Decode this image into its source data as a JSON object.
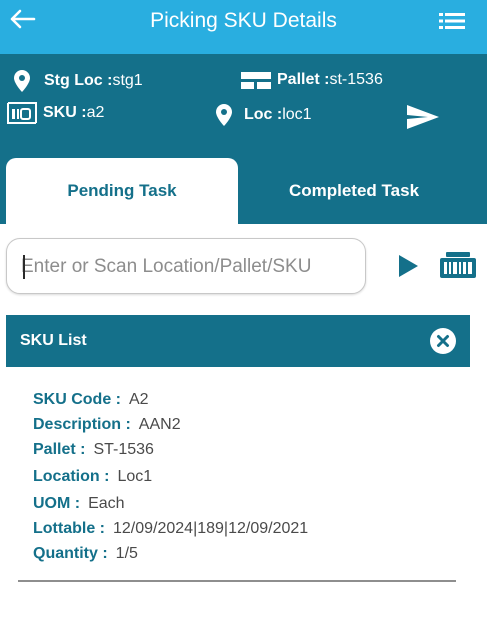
{
  "appbar": {
    "title": "Picking SKU Details"
  },
  "info": {
    "stg_loc_label": "Stg Loc :",
    "stg_loc_value": "stg1",
    "pallet_label": "Pallet :",
    "pallet_value": "st-1536",
    "sku_label": "SKU :",
    "sku_value": "a2",
    "loc_label": "Loc :",
    "loc_value": "loc1"
  },
  "tabs": [
    {
      "label": "Pending Task",
      "active": true
    },
    {
      "label": "Completed Task",
      "active": false
    }
  ],
  "search": {
    "placeholder": "Enter or Scan Location/Pallet/SKU",
    "value": ""
  },
  "sku_list": {
    "title": "SKU List",
    "items": [
      {
        "label": "SKU Code :",
        "value": "A2"
      },
      {
        "label": "Description :",
        "value": "AAN2"
      },
      {
        "label": "Pallet :",
        "value": "ST-1536"
      },
      {
        "label": "Location :",
        "value": "Loc1"
      },
      {
        "label": "UOM :",
        "value": "Each"
      },
      {
        "label": "Lottable :",
        "value": "12/09/2024|189|12/09/2021"
      },
      {
        "label": "Quantity :",
        "value": "1/5"
      }
    ]
  },
  "icons": {
    "back": "arrow-left-icon",
    "menu": "list-menu-icon",
    "stg_loc": "location-pin-icon",
    "pallet": "pallet-icon",
    "sku": "barcode-box-icon",
    "loc": "location-pin-icon",
    "send": "send-icon",
    "play": "play-icon",
    "scan": "barcode-scanner-icon",
    "close": "close-circle-icon"
  },
  "colors": {
    "appbar": "#29aee0",
    "primary": "#14708a",
    "background": "#ffffff"
  }
}
